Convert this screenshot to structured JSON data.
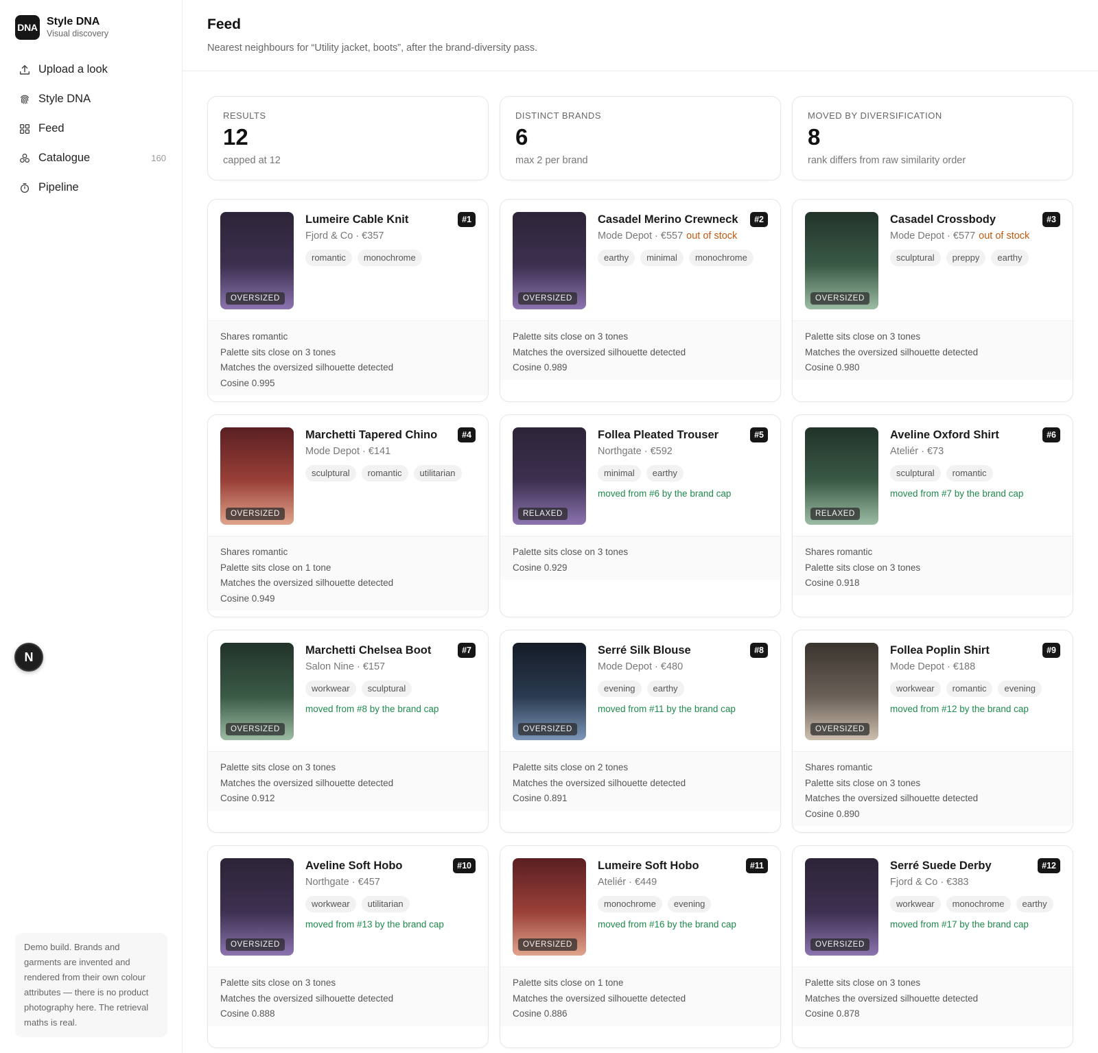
{
  "brand": {
    "logo": "DNA",
    "name": "Style DNA",
    "subtitle": "Visual discovery"
  },
  "nav": [
    {
      "label": "Upload a look",
      "icon": "upload-icon",
      "count": ""
    },
    {
      "label": "Style DNA",
      "icon": "fingerprint-icon",
      "count": ""
    },
    {
      "label": "Feed",
      "icon": "grid-icon",
      "count": ""
    },
    {
      "label": "Catalogue",
      "icon": "hanger-icon",
      "count": "160"
    },
    {
      "label": "Pipeline",
      "icon": "timer-icon",
      "count": ""
    }
  ],
  "fab": {
    "label": "N"
  },
  "note": "Demo build. Brands and garments are invented and rendered from their own colour attributes — there is no product photography here. The retrieval maths is real.",
  "header": {
    "title": "Feed",
    "subtitle": "Nearest neighbours for “Utility jacket, boots”, after the brand-diversity pass."
  },
  "stats": [
    {
      "label": "RESULTS",
      "value": "12",
      "note": "capped at 12"
    },
    {
      "label": "DISTINCT BRANDS",
      "value": "6",
      "note": "max 2 per brand"
    },
    {
      "label": "MOVED BY DIVERSIFICATION",
      "value": "8",
      "note": "rank differs from raw similarity order"
    }
  ],
  "colors": {
    "purple": [
      "#2c2437",
      "#3d3050",
      "#8c74b0"
    ],
    "green": [
      "#22332a",
      "#3a5a46",
      "#9cbca4"
    ],
    "red": [
      "#5a1f22",
      "#9a4038",
      "#e0a48c"
    ],
    "navy": [
      "#151c26",
      "#2a3a50",
      "#7c96b8"
    ],
    "taupe": [
      "#3a342e",
      "#6a6058",
      "#cdbfae"
    ],
    "moved_text": "#1e8a4c",
    "out_of_stock_text": "#c25a10"
  },
  "cards": [
    {
      "rank": "#1",
      "title": "Lumeire Cable Knit",
      "meta": "Fjord & Co · €357",
      "stock": "",
      "tags": [
        "romantic",
        "monochrome"
      ],
      "moved": "",
      "fit": "OVERSIZED",
      "swatch": "purple",
      "reasons": [
        "Shares romantic",
        "Palette sits close on 3 tones",
        "Matches the oversized silhouette detected",
        "Cosine 0.995"
      ]
    },
    {
      "rank": "#2",
      "title": "Casadel Merino Crewneck",
      "meta": "Mode Depot · €557",
      "stock": "out of stock",
      "tags": [
        "earthy",
        "minimal",
        "monochrome"
      ],
      "moved": "",
      "fit": "OVERSIZED",
      "swatch": "purple",
      "reasons": [
        "Palette sits close on 3 tones",
        "Matches the oversized silhouette detected",
        "Cosine 0.989"
      ]
    },
    {
      "rank": "#3",
      "title": "Casadel Crossbody",
      "meta": "Mode Depot · €577",
      "stock": "out of stock",
      "tags": [
        "sculptural",
        "preppy",
        "earthy"
      ],
      "moved": "",
      "fit": "OVERSIZED",
      "swatch": "green",
      "reasons": [
        "Palette sits close on 3 tones",
        "Matches the oversized silhouette detected",
        "Cosine 0.980"
      ]
    },
    {
      "rank": "#4",
      "title": "Marchetti Tapered Chino",
      "meta": "Mode Depot · €141",
      "stock": "",
      "tags": [
        "sculptural",
        "romantic",
        "utilitarian"
      ],
      "moved": "",
      "fit": "OVERSIZED",
      "swatch": "red",
      "reasons": [
        "Shares romantic",
        "Palette sits close on 1 tone",
        "Matches the oversized silhouette detected",
        "Cosine 0.949"
      ]
    },
    {
      "rank": "#5",
      "title": "Follea Pleated Trouser",
      "meta": "Northgate · €592",
      "stock": "",
      "tags": [
        "minimal",
        "earthy"
      ],
      "moved": "moved from #6 by the brand cap",
      "fit": "RELAXED",
      "swatch": "purple",
      "reasons": [
        "Palette sits close on 3 tones",
        "Cosine 0.929"
      ]
    },
    {
      "rank": "#6",
      "title": "Aveline Oxford Shirt",
      "meta": "Ateliér · €73",
      "stock": "",
      "tags": [
        "sculptural",
        "romantic"
      ],
      "moved": "moved from #7 by the brand cap",
      "fit": "RELAXED",
      "swatch": "green",
      "reasons": [
        "Shares romantic",
        "Palette sits close on 3 tones",
        "Cosine 0.918"
      ]
    },
    {
      "rank": "#7",
      "title": "Marchetti Chelsea Boot",
      "meta": "Salon Nine · €157",
      "stock": "",
      "tags": [
        "workwear",
        "sculptural"
      ],
      "moved": "moved from #8 by the brand cap",
      "fit": "OVERSIZED",
      "swatch": "green",
      "reasons": [
        "Palette sits close on 3 tones",
        "Matches the oversized silhouette detected",
        "Cosine 0.912"
      ]
    },
    {
      "rank": "#8",
      "title": "Serré Silk Blouse",
      "meta": "Mode Depot · €480",
      "stock": "",
      "tags": [
        "evening",
        "earthy"
      ],
      "moved": "moved from #11 by the brand cap",
      "fit": "OVERSIZED",
      "swatch": "navy",
      "reasons": [
        "Palette sits close on 2 tones",
        "Matches the oversized silhouette detected",
        "Cosine 0.891"
      ]
    },
    {
      "rank": "#9",
      "title": "Follea Poplin Shirt",
      "meta": "Mode Depot · €188",
      "stock": "",
      "tags": [
        "workwear",
        "romantic",
        "evening"
      ],
      "moved": "moved from #12 by the brand cap",
      "fit": "OVERSIZED",
      "swatch": "taupe",
      "reasons": [
        "Shares romantic",
        "Palette sits close on 3 tones",
        "Matches the oversized silhouette detected",
        "Cosine 0.890"
      ]
    },
    {
      "rank": "#10",
      "title": "Aveline Soft Hobo",
      "meta": "Northgate · €457",
      "stock": "",
      "tags": [
        "workwear",
        "utilitarian"
      ],
      "moved": "moved from #13 by the brand cap",
      "fit": "OVERSIZED",
      "swatch": "purple",
      "reasons": [
        "Palette sits close on 3 tones",
        "Matches the oversized silhouette detected",
        "Cosine 0.888"
      ]
    },
    {
      "rank": "#11",
      "title": "Lumeire Soft Hobo",
      "meta": "Ateliér · €449",
      "stock": "",
      "tags": [
        "monochrome",
        "evening"
      ],
      "moved": "moved from #16 by the brand cap",
      "fit": "OVERSIZED",
      "swatch": "red",
      "reasons": [
        "Palette sits close on 1 tone",
        "Matches the oversized silhouette detected",
        "Cosine 0.886"
      ]
    },
    {
      "rank": "#12",
      "title": "Serré Suede Derby",
      "meta": "Fjord & Co · €383",
      "stock": "",
      "tags": [
        "workwear",
        "monochrome",
        "earthy"
      ],
      "moved": "moved from #17 by the brand cap",
      "fit": "OVERSIZED",
      "swatch": "purple",
      "reasons": [
        "Palette sits close on 3 tones",
        "Matches the oversized silhouette detected",
        "Cosine 0.878"
      ]
    }
  ]
}
